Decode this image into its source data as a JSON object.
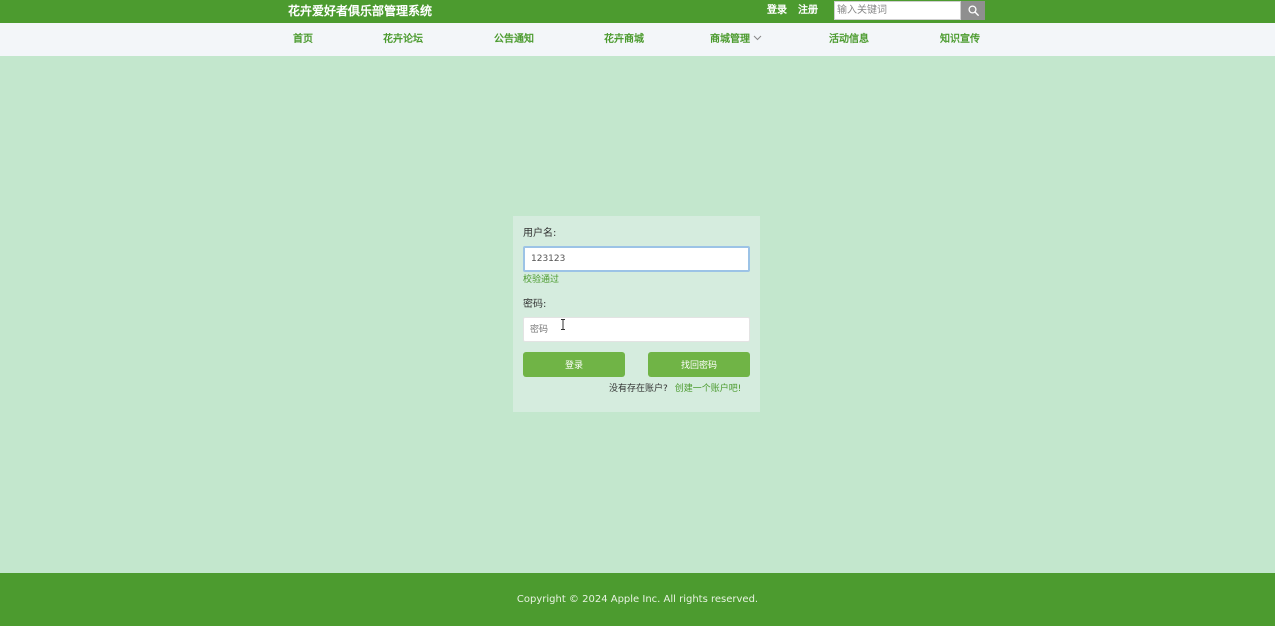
{
  "header": {
    "site_title": "花卉爱好者俱乐部管理系统",
    "login_label": "登录",
    "register_label": "注册",
    "search": {
      "placeholder": "输入关键词",
      "value": ""
    },
    "search_icon": "search-icon"
  },
  "nav": {
    "items": [
      {
        "label": "首页"
      },
      {
        "label": "花卉论坛"
      },
      {
        "label": "公告通知"
      },
      {
        "label": "花卉商城"
      },
      {
        "label": "商城管理",
        "icon": "chevron-down-icon"
      },
      {
        "label": "活动信息"
      },
      {
        "label": "知识宣传"
      }
    ]
  },
  "login_form": {
    "username_label": "用户名:",
    "username_value": "123123",
    "validation_message": "校验通过",
    "password_label": "密码:",
    "password_placeholder": "密码",
    "login_button": "登录",
    "retrieve_button": "找回密码",
    "no_account_text": "没有存在账户?",
    "create_account_link": "创建一个账户吧!"
  },
  "footer": {
    "copyright": "Copyright © 2024 Apple Inc. All rights reserved."
  },
  "colors": {
    "brand_green": "#4c9b2f",
    "button_green": "#70b446",
    "page_background": "#c3e7cd",
    "panel_background": "#d5ecde",
    "nav_background": "#f3f6f9",
    "search_button": "#8f8f8f"
  }
}
